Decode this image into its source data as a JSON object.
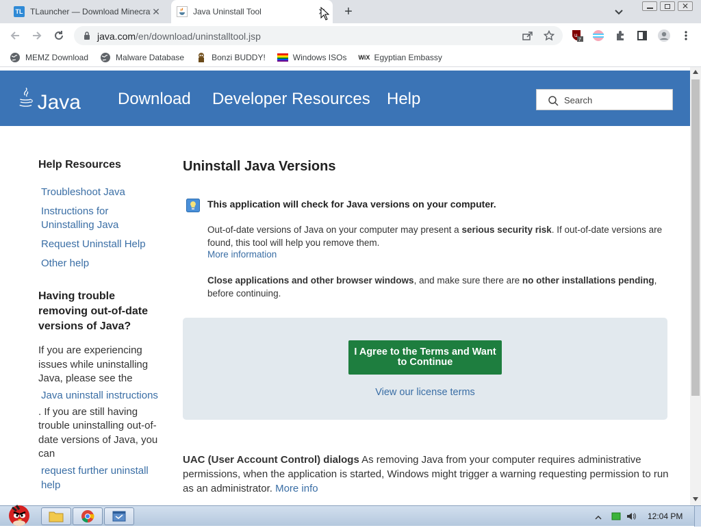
{
  "browser": {
    "tabs": [
      {
        "title": "TLauncher — Download Minecraft",
        "favicon": "TL",
        "active": false
      },
      {
        "title": "Java Uninstall Tool",
        "active": true
      }
    ],
    "url_domain": "java.com",
    "url_path": "/en/download/uninstalltool.jsp",
    "extension_badge": "7",
    "bookmarks": [
      {
        "label": "MEMZ Download",
        "icon": "globe-icon"
      },
      {
        "label": "Malware Database",
        "icon": "globe-icon"
      },
      {
        "label": "Bonzi BUDDY!",
        "icon": "bonzi-icon"
      },
      {
        "label": "Windows ISOs",
        "icon": "rainbow-flag-icon"
      },
      {
        "label": "Egyptian Embassy",
        "icon": "wix-icon"
      }
    ]
  },
  "page": {
    "brand": "Java",
    "nav": [
      "Download",
      "Developer Resources",
      "Help"
    ],
    "search_placeholder": "Search",
    "sidebar": {
      "heading": "Help Resources",
      "links": [
        "Troubleshoot Java",
        "Instructions for Uninstalling Java",
        "Request Uninstall Help",
        "Other help"
      ],
      "trouble_heading": "Having trouble removing out-of-date versions of Java?",
      "trouble_text_1": "If you are experiencing issues while uninstalling Java, please see the",
      "trouble_link_1": "Java uninstall instructions",
      "trouble_text_2": ". If you are still having trouble uninstalling out-of-date versions of Java, you can",
      "trouble_link_2": "request further uninstall help"
    },
    "main": {
      "heading": "Uninstall Java Versions",
      "info_bold": "This application will check for Java versions on your computer.",
      "p1_before": "Out-of-date versions of Java on your computer may present a ",
      "p1_bold": "serious security risk",
      "p1_after": ". If out-of-date versions are found, this tool will help you remove them.",
      "more_information": "More information",
      "p2_bold1": "Close applications and other browser windows",
      "p2_mid": ", and make sure there are ",
      "p2_bold2": "no other installations pending",
      "p2_end": ", before continuing.",
      "agree_button": "I Agree to the Terms and Want to Continue",
      "license_link": "View our license terms",
      "uac_bold": "UAC (User Account Control) dialogs",
      "uac_text": " As removing Java from your computer requires administrative permissions, when the application is started, Windows might trigger a warning requesting permission to run as an administrator.",
      "uac_link": "More info"
    }
  },
  "taskbar": {
    "clock": "12:04 PM"
  },
  "colors": {
    "java_blue": "#3b74b6",
    "agree_green": "#1e7e3f",
    "link_blue": "#3a6ea5",
    "panel_bg": "#e2e9ee"
  }
}
